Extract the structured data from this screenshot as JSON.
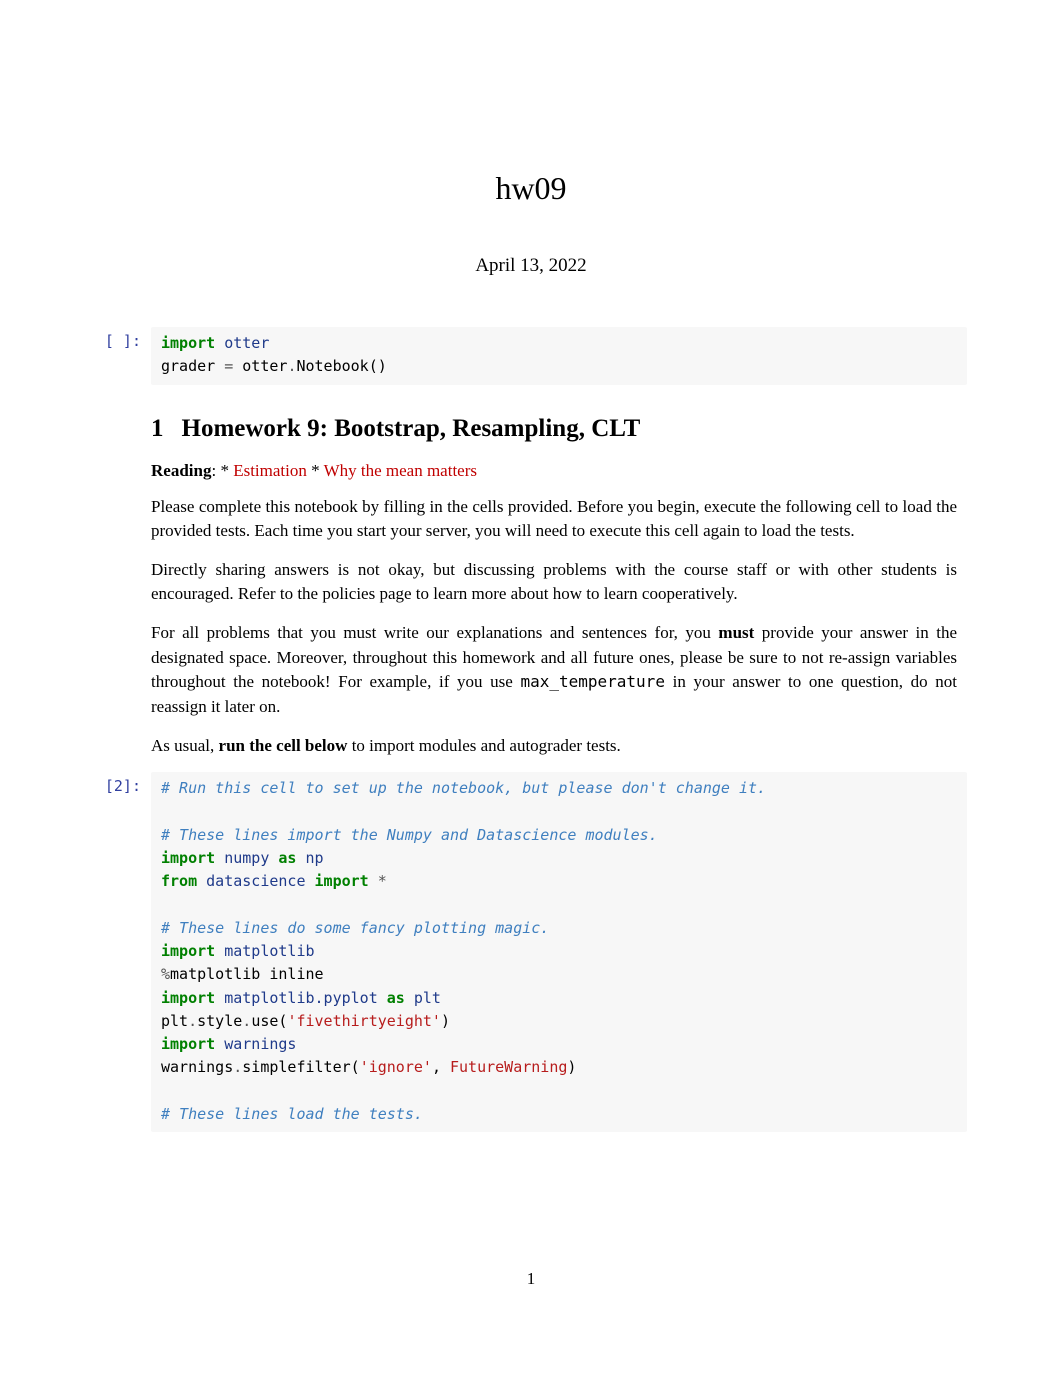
{
  "title": "hw09",
  "date": "April 13, 2022",
  "cells": {
    "c1": {
      "prompt": "[ ]:",
      "line1_kw": "import",
      "line1_mod": "otter",
      "line2_lhs": "grader ",
      "line2_op": "=",
      "line2_rhs1": " otter",
      "line2_dot": ".",
      "line2_call": "Notebook()"
    },
    "section": {
      "number": "1",
      "title": "Homework 9: Bootstrap, Resampling, CLT"
    },
    "reading": {
      "label": "Reading",
      "sep1": ": * ",
      "link1": "Estimation",
      "sep2": " * ",
      "link2": "Why the mean matters"
    },
    "p1a": "Please complete this notebook by filling in the cells provided. ",
    "p1b": "Before you begin, execute the following cell to load the provided tests. Each time you start your server, you will need to execute this cell again to load the tests.",
    "p2": "Directly sharing answers is not okay, but discussing problems with the course staff or with other students is encouraged. Refer to the policies page to learn more about how to learn cooperatively.",
    "p3a": "For all problems that you must write our explanations and sentences for, you ",
    "p3_must": "must",
    "p3b": " provide your answer in the designated space. Moreover, throughout this homework and all future ones, please be sure to not re-assign variables throughout the notebook! For example, if you use ",
    "p3_code": "max_temperature",
    "p3c": " in your answer to one question, do not reassign it later on.",
    "p4a": "As usual, ",
    "p4_bold": "run the cell below",
    "p4b": " to import modules and autograder tests.",
    "c2": {
      "prompt": "[2]:",
      "l01": "# Run this cell to set up the notebook, but please don't change it.",
      "l03": "# These lines import the Numpy and Datascience modules.",
      "l04_kw1": "import",
      "l04_mod": "numpy",
      "l04_as": "as",
      "l04_alias": "np",
      "l05_from": "from",
      "l05_mod": "datascience",
      "l05_import": "import",
      "l05_star": "*",
      "l07": "# These lines do some fancy plotting magic.",
      "l08_kw": "import",
      "l08_mod": "matplotlib",
      "l09_pct": "%",
      "l09_magic": "matplotlib",
      "l09_arg": " inline",
      "l10_kw": "import",
      "l10_mod": "matplotlib.pyplot",
      "l10_as": "as",
      "l10_alias": "plt",
      "l11_a": "plt",
      "l11_dot1": ".",
      "l11_b": "style",
      "l11_dot2": ".",
      "l11_c": "use(",
      "l11_str": "'fivethirtyeight'",
      "l11_d": ")",
      "l12_kw": "import",
      "l12_mod": "warnings",
      "l13_a": "warnings",
      "l13_dot": ".",
      "l13_b": "simplefilter(",
      "l13_str": "'ignore'",
      "l13_c": ", ",
      "l13_cls": "FutureWarning",
      "l13_d": ")",
      "l15": "# These lines load the tests."
    }
  },
  "page_number": "1"
}
